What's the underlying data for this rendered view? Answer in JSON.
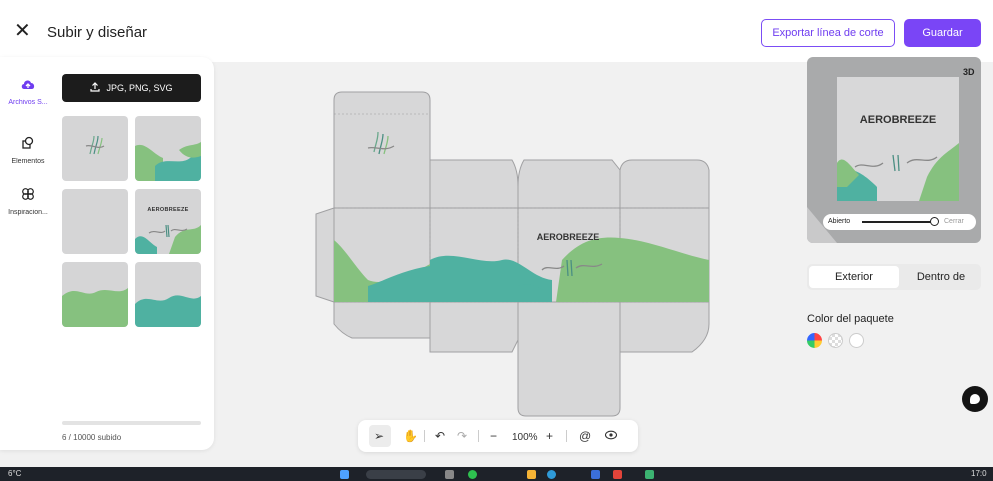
{
  "header": {
    "close_icon": "close-icon",
    "title": "Subir y diseñar",
    "export_label": "Exportar línea de corte",
    "save_label": "Guardar"
  },
  "sidebar": {
    "items": [
      {
        "label": "Archivos S...",
        "icon": "cloud-upload-icon",
        "active": true
      },
      {
        "label": "Elementos",
        "icon": "shapes-icon",
        "active": false
      },
      {
        "label": "Inspiracion...",
        "icon": "sparkle-icon",
        "active": false
      }
    ]
  },
  "uploads": {
    "button_label": "JPG, PNG, SVG",
    "button_icon": "upload-icon",
    "thumb_brand": "AEROBREEZE",
    "count_label": "6 / 10000 subido"
  },
  "design": {
    "brand": "AEROBREEZE",
    "colors": {
      "panel": "#d7d7d8",
      "teal": "#4fb1a1",
      "green": "#86c17f",
      "accent": "#7a45f6"
    }
  },
  "toolbar": {
    "zoom": "100%",
    "minus": "−",
    "plus": "+",
    "icons": [
      "select-icon",
      "hand-icon",
      "undo-icon",
      "redo-icon",
      "zoom-out-icon",
      "zoom-in-icon",
      "at-icon",
      "eye-icon"
    ]
  },
  "preview": {
    "badge": "3D",
    "brand": "AEROBREEZE",
    "open_label": "Abierto",
    "close_label": "Cerrar",
    "open_state": 0.95
  },
  "tabs": {
    "exterior": "Exterior",
    "inside": "Dentro de"
  },
  "color_section": {
    "title": "Color del paquete",
    "swatches": [
      "multicolor",
      "transparent",
      "#ffffff"
    ]
  },
  "taskbar": {
    "weather": "6°C",
    "clock": "17:0"
  }
}
